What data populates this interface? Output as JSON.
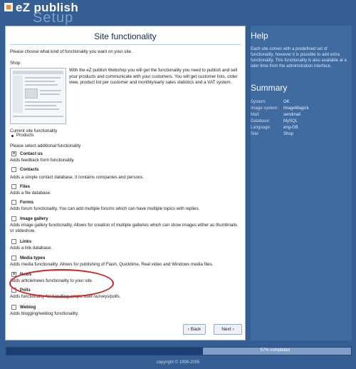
{
  "logo": {
    "name": "eZ publish",
    "sub": "Setup",
    "icon": "ez-logo-icon"
  },
  "main": {
    "title": "Site functionality",
    "intro": "Please choose what kind of functionality you want on your site.",
    "shop_label": "Shop",
    "shop_description": "With the eZ publish Webshop you will get the functionality you need to publish and sell your products and communicate with your customers. You will get customer lists, order view, product list per customer and monthly/early sales statistics and a VAT system.",
    "current_label": "Current site functionality",
    "current_items": [
      "Products"
    ],
    "select_label": "Please select additional functionality",
    "options": [
      {
        "label": "Contact us",
        "desc": "Adds feedback form functionality.",
        "checked": true
      },
      {
        "label": "Contacts",
        "desc": "Adds a simple contact database, it contains companies and persons.",
        "checked": false
      },
      {
        "label": "Files",
        "desc": "Adds a file database.",
        "checked": false
      },
      {
        "label": "Forms",
        "desc": "Adds forum functionality. You can add multiple forums which can have multiple topics with replies.",
        "checked": false
      },
      {
        "label": "Image gallery",
        "desc": "Adds image gallery functionality. Allows for creation of multiple galleries which can show images either as thumbnails or slideshow.",
        "checked": false
      },
      {
        "label": "Links",
        "desc": "Adds a link database.",
        "checked": false
      },
      {
        "label": "Media types",
        "desc": "Adds media functionality. Allows for publishing of Flash, Quicktime, Real video and Windows media files.",
        "checked": false
      },
      {
        "label": "News",
        "desc": "Adds article/news functionality to your site.",
        "checked": true
      },
      {
        "label": "Polls",
        "desc": "Adds functionality for handling simple user-surveys/polls.",
        "checked": false
      },
      {
        "label": "Weblog",
        "desc": "Adds blogging/weblog functionality.",
        "checked": false
      }
    ],
    "back_label": "Back",
    "next_label": "Next",
    "highlight_color": "#d61f1f"
  },
  "help": {
    "title": "Help",
    "text": "Each site comes with a predefined set of functionality, however it is possible to add extra functionality. This functionality is also available at a later time from the administration interface."
  },
  "summary": {
    "title": "Summary",
    "rows": [
      {
        "key": "System:",
        "value": "OK"
      },
      {
        "key": "Image system:",
        "value": "ImageMagick"
      },
      {
        "key": "Mail:",
        "value": "sendmail"
      },
      {
        "key": "Database:",
        "value": "MySQL"
      },
      {
        "key": "Language:",
        "value": "eng-GB"
      },
      {
        "key": "Site:",
        "value": "Shop"
      }
    ]
  },
  "progress": {
    "percent": 57,
    "text": "57% completed"
  },
  "footer": {
    "copyright": "copyright © 1999-2005"
  },
  "colors": {
    "background": "#355f94",
    "panel": "#3f6ba1",
    "progress_fill": "#1a3d72"
  }
}
